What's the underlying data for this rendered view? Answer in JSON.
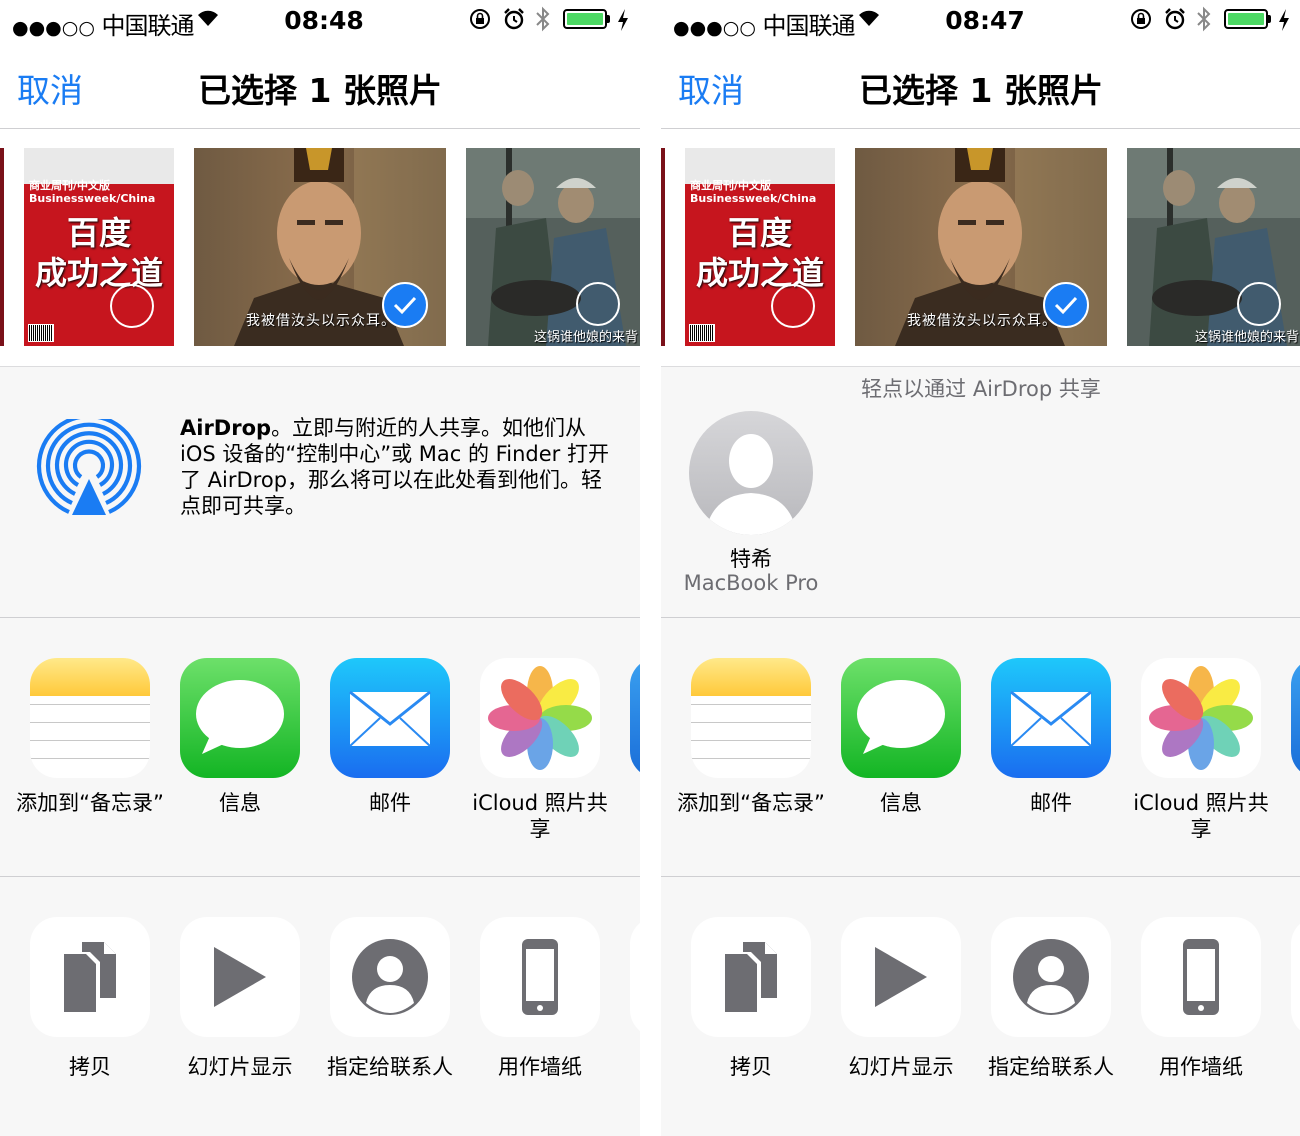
{
  "status_bar": {
    "signal_dots": "●●●○○",
    "carrier": "中国联通",
    "left_time": "08:48",
    "right_time": "08:47"
  },
  "nav": {
    "cancel": "取消",
    "title": "已选择 1 张照片"
  },
  "photos": {
    "magazine_brand_line1": "商业周刊/中文版",
    "magazine_brand_line2": "Businessweek/China",
    "magazine_title_line1": "百度",
    "magazine_title_line2": "成功之道",
    "zhuge_subtitle": "我被借汝头以示众耳。",
    "soldier_subtitle": "这锅谁他娘的来背"
  },
  "airdrop": {
    "bold": "AirDrop",
    "description": "。立即与附近的人共享。如他们从 iOS 设备的“控制中心”或 Mac 的 Finder 打开了 AirDrop，那么将可以在此处看到他们。轻点即可共享。",
    "hint": "轻点以通过 AirDrop 共享",
    "device_name": "特希",
    "device_model": "MacBook Pro"
  },
  "apps": [
    "添加到“备忘录”",
    "信息",
    "邮件",
    "iCloud 照片共享"
  ],
  "actions": [
    "拷贝",
    "幻灯片显示",
    "指定给联系人",
    "用作墙纸"
  ],
  "colors": {
    "accent": "#1a7cf3",
    "battery": "#4cd964",
    "background": "#f7f7f7",
    "secondary_text": "#6d6d72"
  }
}
